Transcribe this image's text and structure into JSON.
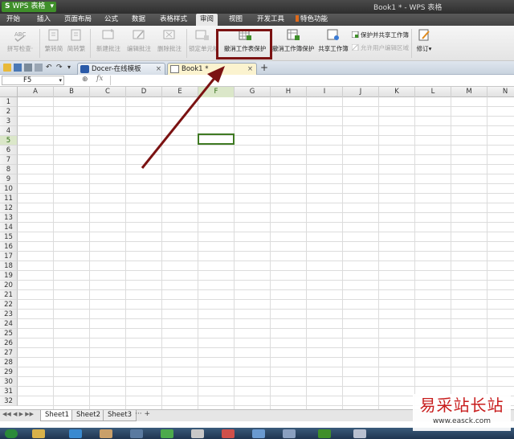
{
  "titlebar": {
    "app_logo": "S",
    "app_name": "WPS 表格",
    "dropdown": "▾",
    "title": "Book1 * - WPS 表格"
  },
  "menu": {
    "tabs": [
      "开始",
      "插入",
      "页面布局",
      "公式",
      "数据",
      "表格样式",
      "审阅",
      "视图",
      "开发工具",
      "特色功能"
    ],
    "active": "审阅"
  },
  "ribbon": {
    "spell_check": "拼写检查",
    "spell_check_dd": "·",
    "simp_trad_1": "繁转简",
    "simp_trad_2": "简转繁",
    "new_comment": "新建批注",
    "edit_comment": "编辑批注",
    "delete_comment": "删除批注",
    "lock_cell": "锁定单元格",
    "unprotect_sheet": "撤消工作表保护",
    "unprotect_workbook": "撤消工作簿保护",
    "share_workbook": "共享工作簿",
    "protect_share": "保护并共享工作簿",
    "allow_edit_ranges": "允许用户编辑区域",
    "revise": "修订",
    "revise_dd": "▾"
  },
  "tabs": {
    "docer": "Docer-在线模板",
    "book1": "Book1 *",
    "close_glyph": "×",
    "add_glyph": "+"
  },
  "formula": {
    "cell_ref": "F5",
    "fx": "fx",
    "dropdown": "▾",
    "zoom_glyph": "⊕"
  },
  "grid": {
    "columns": [
      "A",
      "B",
      "C",
      "D",
      "E",
      "F",
      "G",
      "H",
      "I",
      "J",
      "K",
      "L",
      "M",
      "N"
    ],
    "rows": [
      "1",
      "2",
      "3",
      "4",
      "5",
      "6",
      "7",
      "8",
      "9",
      "10",
      "11",
      "12",
      "13",
      "14",
      "15",
      "16",
      "17",
      "18",
      "19",
      "20",
      "21",
      "22",
      "23",
      "24",
      "25",
      "26",
      "27",
      "28",
      "29",
      "30",
      "31",
      "32"
    ],
    "selected_col": "F",
    "selected_row": "5"
  },
  "sheets": {
    "tabs": [
      "Sheet1",
      "Sheet2",
      "Sheet3"
    ],
    "active": "Sheet1",
    "more": "··· +",
    "nav": "◀◀ ◀ ▶ ▶▶"
  },
  "watermark": {
    "main": "易采站长站",
    "sub": "www.easck.com"
  },
  "colors": {
    "accent_green": "#3f8f2a",
    "highlight_box": "#7b1212",
    "arrow": "#7b1212",
    "selection": "#3f7a23"
  }
}
